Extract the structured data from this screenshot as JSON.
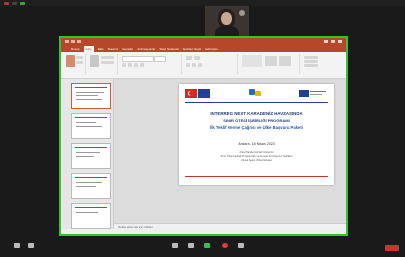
{
  "zoom": {
    "share_status": "",
    "controls": [
      {
        "name": "mute"
      },
      {
        "name": "video"
      },
      {
        "name": "security"
      },
      {
        "name": "participants"
      },
      {
        "name": "chat"
      },
      {
        "name": "share-screen"
      },
      {
        "name": "record"
      },
      {
        "name": "reactions"
      }
    ]
  },
  "ppt": {
    "tabs": [
      "Dosya",
      "Giriş",
      "Ekle",
      "Tasarım",
      "Geçişler",
      "Animasyonlar",
      "Slayt Gösterisi",
      "Gözden Geçir",
      "Görünüm"
    ],
    "notes_placeholder": "Notlar eklemek için tıklatın"
  },
  "slide": {
    "logo_text": "Black Sea",
    "title": "INTERREG NEXT KARADENİZ HAVZASINDA",
    "subtitle": "SINIR ÖTESİ İŞBİRLİĞİ PROGRAMI",
    "call": "İlk Teklif Verme Çağrısı ve Ülke Başvuru Paketi",
    "date": "Ankara, 18 Nisan 2023",
    "lines": [
      "Arka Planda Görsel Gösterimi",
      "Sınır Ötesi İşbirliği Programları ve Avrupa Komisyonu Yetkilileri",
      "Ulusal Ajans İrtibat Noktası"
    ]
  }
}
